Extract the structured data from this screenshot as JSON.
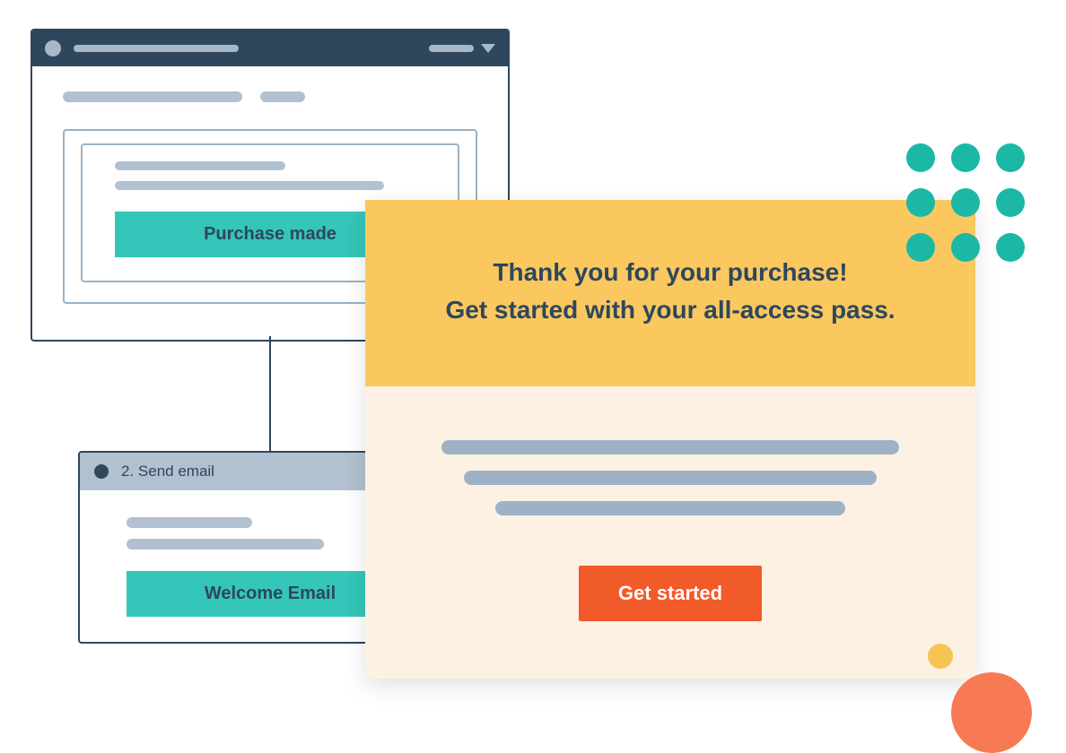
{
  "workflow": {
    "trigger_button": "Purchase made",
    "step2": {
      "label": "2. Send email",
      "action_button": "Welcome Email"
    }
  },
  "email_preview": {
    "heading_line1": "Thank you for your purchase!",
    "heading_line2": "Get started with your all-access pass.",
    "cta_label": "Get started"
  },
  "colors": {
    "navy": "#2e475d",
    "teal": "#33c6b9",
    "teal_dot": "#1bb8a5",
    "yellow": "#fac85f",
    "cream": "#fdf1e4",
    "orange": "#f15a29",
    "grey": "#b2c1cf"
  }
}
